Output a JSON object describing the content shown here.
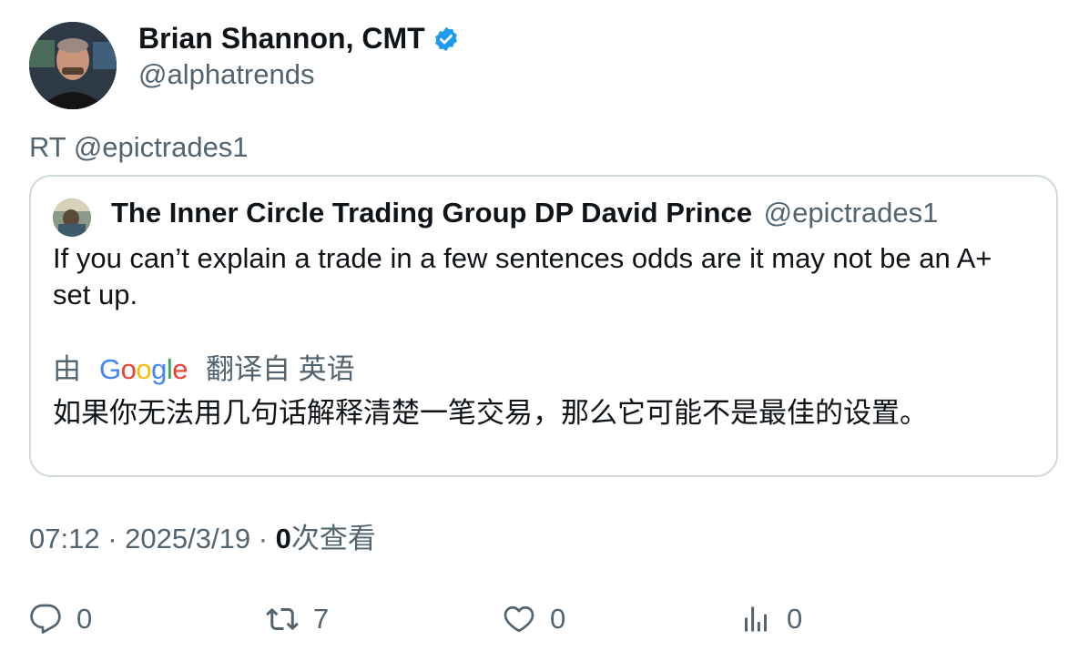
{
  "author": {
    "name": "Brian Shannon, CMT",
    "handle": "@alphatrends",
    "verified_icon": "verified-badge-icon",
    "badge_color": "#1d9bf0"
  },
  "retweet_text": "RT @epictrades1",
  "quote": {
    "name": "The Inner Circle Trading Group DP David Prince",
    "handle": "@epictrades1",
    "text": "If you can’t explain a trade in a few sentences odds are it may not be an A+ set up.",
    "translation": {
      "by_label": "由",
      "google_logo": [
        "G",
        "o",
        "o",
        "g",
        "l",
        "e"
      ],
      "google_colors": [
        "#4285f4",
        "#ea4335",
        "#fbbc05",
        "#4285f4",
        "#34a853",
        "#ea4335"
      ],
      "from_label": "翻译自 英语",
      "text": "如果你无法用几句话解释清楚一笔交易，那么它可能不是最佳的设置。"
    }
  },
  "meta": {
    "time": "07:12",
    "sep1": "·",
    "date": "2025/3/19",
    "sep2": "·",
    "views_count": "0",
    "views_label": "次查看"
  },
  "actions": {
    "reply": {
      "icon": "reply-icon",
      "count": "0"
    },
    "retweet": {
      "icon": "retweet-icon",
      "count": "7"
    },
    "like": {
      "icon": "heart-icon",
      "count": "0"
    },
    "views": {
      "icon": "analytics-icon",
      "count": "0"
    }
  },
  "colors": {
    "text_primary": "#0f1419",
    "text_secondary": "#536471",
    "border": "#cfd9de"
  }
}
